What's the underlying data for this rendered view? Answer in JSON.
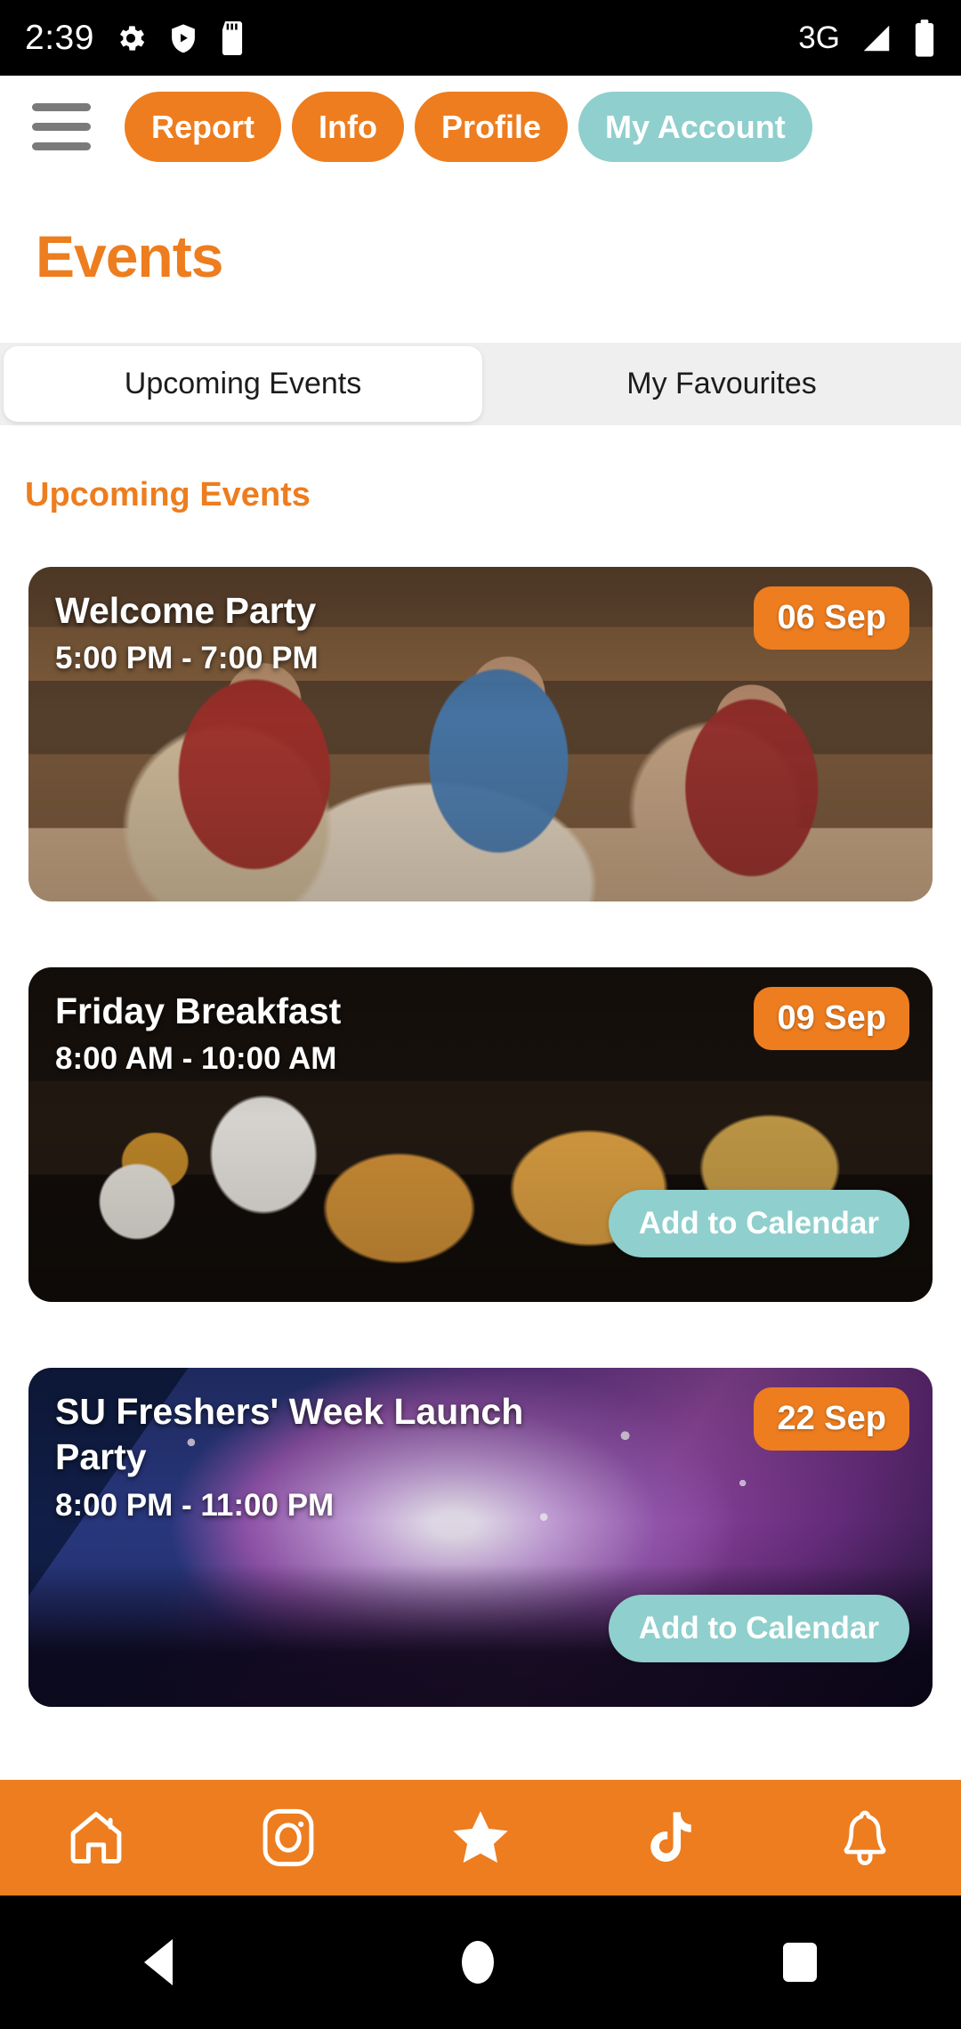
{
  "status_bar": {
    "time": "2:39",
    "network": "3G",
    "left_icons": [
      "gear-icon",
      "shield-play-icon",
      "sd-card-icon"
    ],
    "right_icons": [
      "signal-icon",
      "battery-icon"
    ]
  },
  "top_nav": {
    "menu_icon": "hamburger-menu-icon",
    "pills": [
      {
        "label": "Report",
        "style": "orange"
      },
      {
        "label": "Info",
        "style": "orange"
      },
      {
        "label": "Profile",
        "style": "orange"
      },
      {
        "label": "My Account",
        "style": "teal"
      }
    ]
  },
  "page": {
    "title": "Events",
    "section_heading": "Upcoming Events"
  },
  "tabs": [
    {
      "label": "Upcoming Events",
      "active": true
    },
    {
      "label": "My Favourites",
      "active": false
    }
  ],
  "events": [
    {
      "title": "Welcome Party",
      "time": "5:00 PM - 7:00 PM",
      "date": "06 Sep",
      "calendar_button": null
    },
    {
      "title": "Friday Breakfast",
      "time": "8:00 AM - 10:00 AM",
      "date": "09 Sep",
      "calendar_button": "Add to Calendar"
    },
    {
      "title": "SU Freshers' Week Launch Party",
      "time": "8:00 PM - 11:00 PM",
      "date": "22 Sep",
      "calendar_button": "Add to Calendar"
    }
  ],
  "bottom_nav": [
    {
      "icon": "home-icon"
    },
    {
      "icon": "instagram-icon"
    },
    {
      "icon": "star-icon",
      "active": true
    },
    {
      "icon": "tiktok-icon"
    },
    {
      "icon": "bell-icon"
    }
  ],
  "system_nav": [
    {
      "icon": "back-icon"
    },
    {
      "icon": "home-circle-icon"
    },
    {
      "icon": "recents-square-icon"
    }
  ],
  "colors": {
    "brand_orange": "#ED7D1F",
    "brand_teal": "#8FCFCD",
    "tabbar_bg": "#EFEFEF",
    "page_bg": "#FFFFFF"
  }
}
